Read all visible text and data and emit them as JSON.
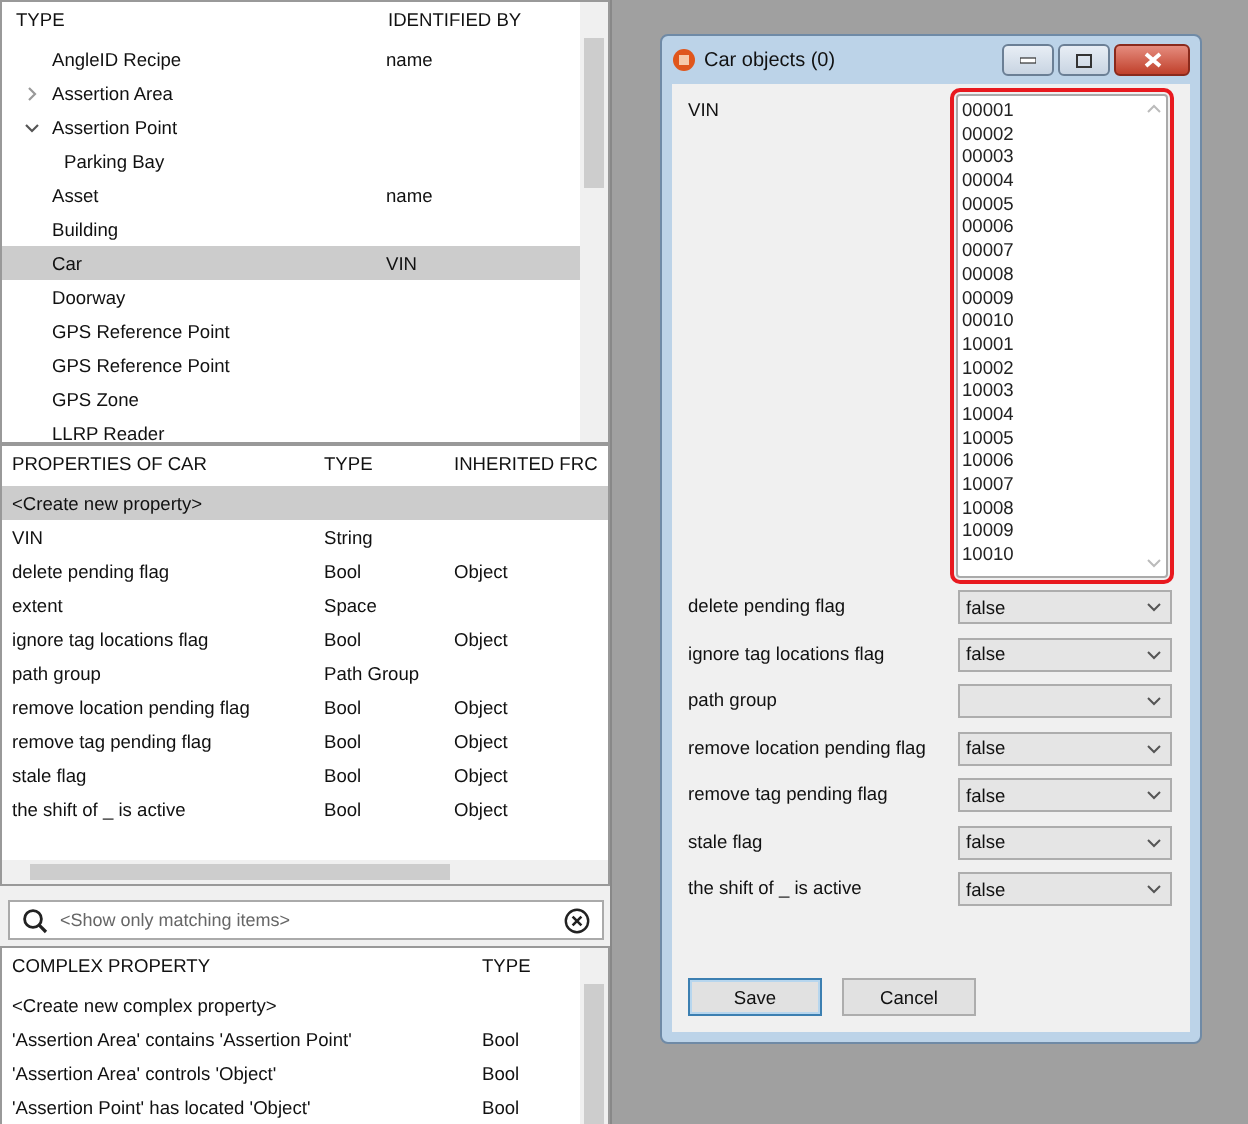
{
  "types": {
    "columns": [
      "TYPE",
      "IDENTIFIED BY"
    ],
    "rows": [
      {
        "name": "AngleID Recipe",
        "identified_by": "name",
        "selected": false
      },
      {
        "name": "Assertion Area",
        "identified_by": "",
        "selected": false,
        "expandable": true,
        "expanded": false
      },
      {
        "name": "Assertion Point",
        "identified_by": "",
        "selected": false,
        "expandable": true,
        "expanded": true,
        "children": [
          {
            "name": "Parking Bay",
            "selected": false
          }
        ]
      },
      {
        "name": "Asset",
        "identified_by": "name",
        "selected": false
      },
      {
        "name": "Building",
        "identified_by": "",
        "selected": false
      },
      {
        "name": "Car",
        "identified_by": "VIN",
        "selected": true
      },
      {
        "name": "Doorway",
        "identified_by": "",
        "selected": false
      },
      {
        "name": "GPS Reference Point",
        "identified_by": "",
        "selected": false
      },
      {
        "name": "GPS Reference Point",
        "identified_by": "",
        "selected": false
      },
      {
        "name": "GPS Zone",
        "identified_by": "",
        "selected": false
      },
      {
        "name": "LLRP Reader",
        "identified_by": "",
        "selected": false
      }
    ]
  },
  "properties": {
    "columns": [
      "PROPERTIES OF CAR",
      "TYPE",
      "INHERITED FRC"
    ],
    "rows": [
      {
        "name": "<Create new property>",
        "type": "",
        "inherited": "",
        "selected": true
      },
      {
        "name": "VIN",
        "type": "String",
        "inherited": "",
        "selected": false
      },
      {
        "name": "delete pending flag",
        "type": "Bool",
        "inherited": "Object",
        "selected": false
      },
      {
        "name": "extent",
        "type": "Space",
        "inherited": "",
        "selected": false
      },
      {
        "name": "ignore tag locations flag",
        "type": "Bool",
        "inherited": "Object",
        "selected": false
      },
      {
        "name": "path group",
        "type": "Path Group",
        "inherited": "",
        "selected": false
      },
      {
        "name": "remove location pending flag",
        "type": "Bool",
        "inherited": "Object",
        "selected": false
      },
      {
        "name": "remove tag pending flag",
        "type": "Bool",
        "inherited": "Object",
        "selected": false
      },
      {
        "name": "stale flag",
        "type": "Bool",
        "inherited": "Object",
        "selected": false
      },
      {
        "name": "the shift of _ is active",
        "type": "Bool",
        "inherited": "Object",
        "selected": false
      }
    ]
  },
  "search": {
    "placeholder": "<Show only matching items>"
  },
  "complex": {
    "columns": [
      "COMPLEX PROPERTY",
      "TYPE"
    ],
    "rows": [
      {
        "name": "<Create new complex property>",
        "type": ""
      },
      {
        "name": "'Assertion Area' contains 'Assertion Point'",
        "type": "Bool"
      },
      {
        "name": "'Assertion Area' controls 'Object'",
        "type": "Bool"
      },
      {
        "name": "'Assertion Point' has located 'Object'",
        "type": "Bool"
      }
    ]
  },
  "dialog": {
    "title": "Car objects (0)",
    "vin": {
      "label": "VIN",
      "highlighted": true,
      "values": [
        "00001",
        "00002",
        "00003",
        "00004",
        "00005",
        "00006",
        "00007",
        "00008",
        "00009",
        "00010",
        "10001",
        "10002",
        "10003",
        "10004",
        "10005",
        "10006",
        "10007",
        "10008",
        "10009",
        "10010"
      ]
    },
    "fields": [
      {
        "label": "delete pending flag",
        "value": "false"
      },
      {
        "label": "ignore tag locations flag",
        "value": "false"
      },
      {
        "label": "path group"
      },
      {
        "label": "remove location pending flag",
        "value": "false"
      },
      {
        "label": "remove tag pending flag",
        "value": "false"
      },
      {
        "label": "stale flag",
        "value": "false"
      },
      {
        "label": "the shift of _ is active",
        "value": "false"
      }
    ],
    "buttons": [
      {
        "label": "Save",
        "default": true
      },
      {
        "label": "Cancel",
        "default": false
      }
    ]
  }
}
